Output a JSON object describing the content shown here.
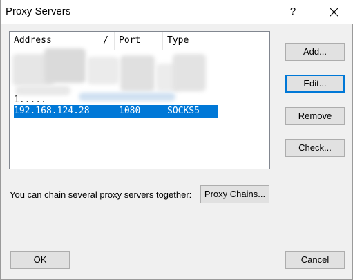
{
  "window": {
    "title": "Proxy Servers",
    "help_label": "?"
  },
  "list": {
    "columns": [
      {
        "label": "Address",
        "sort_indicator": "/"
      },
      {
        "label": "Port"
      },
      {
        "label": "Type"
      }
    ],
    "partial_row_text": "1.....",
    "selected_row": {
      "address": "192.168.124.28",
      "port": "1080",
      "type": "SOCKS5"
    }
  },
  "side_buttons": {
    "add": "Add...",
    "edit": "Edit...",
    "remove": "Remove",
    "check": "Check..."
  },
  "chain": {
    "label": "You can chain several proxy servers together:",
    "button": "Proxy Chains..."
  },
  "footer": {
    "ok": "OK",
    "cancel": "Cancel"
  },
  "colors": {
    "selection": "#0078d7",
    "focus_border": "#0078d7",
    "dialog_bg": "#f0f0f0",
    "button_bg": "#e1e1e1"
  }
}
